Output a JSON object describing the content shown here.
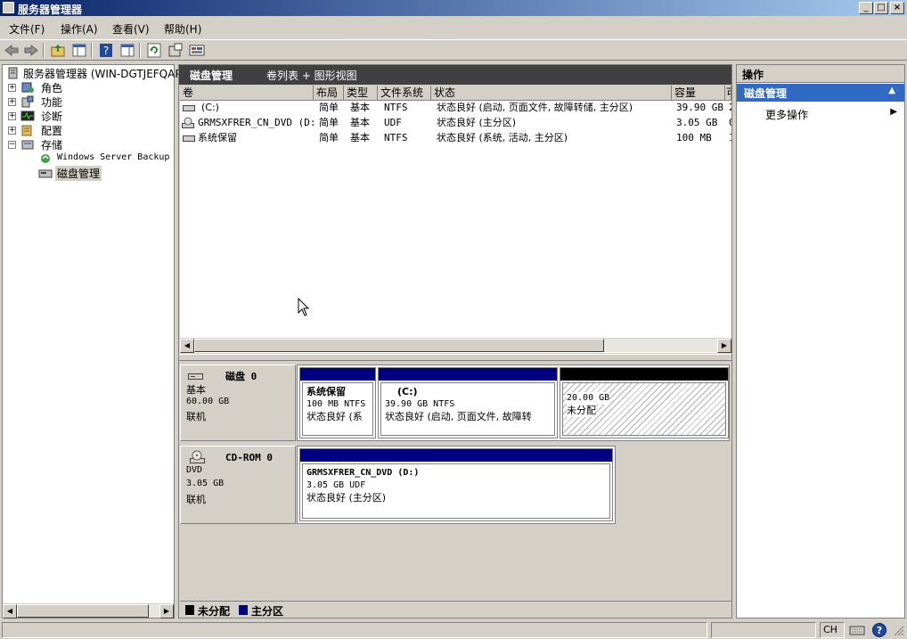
{
  "window": {
    "title": "服务器管理器",
    "controls": [
      "minimize",
      "maximize",
      "close"
    ]
  },
  "menubar": {
    "items": [
      "文件(F)",
      "操作(A)",
      "查看(V)",
      "帮助(H)"
    ]
  },
  "toolbar": {
    "icons": [
      "back-arrow-icon",
      "forward-arrow-icon",
      "up-folder-icon",
      "console-tree-icon",
      "help-icon",
      "properties-pane-icon",
      "refresh-icon",
      "properties-icon",
      "disk-settings-icon"
    ]
  },
  "tree": {
    "root": "服务器管理器 (WIN-DGTJEFQAPR",
    "items": [
      {
        "label": "角色",
        "expander": "+"
      },
      {
        "label": "功能",
        "expander": "+"
      },
      {
        "label": "诊断",
        "expander": "+"
      },
      {
        "label": "配置",
        "expander": "+"
      },
      {
        "label": "存储",
        "expander": "−"
      }
    ],
    "children": [
      "Windows Server Backup",
      "磁盘管理"
    ]
  },
  "center": {
    "title": "磁盘管理",
    "view_label": "卷列表 + 图形视图",
    "columns": [
      "卷",
      "布局",
      "类型",
      "文件系统",
      "状态",
      "容量",
      "可"
    ],
    "rows": [
      {
        "volume": "(C:)",
        "layout": "简单",
        "type": "基本",
        "fs": "NTFS",
        "status": "状态良好 (启动, 页面文件, 故障转储, 主分区)",
        "capacity": "39.90 GB",
        "free": "2"
      },
      {
        "volume": "GRMSXFRER_CN_DVD (D:)",
        "layout": "简单",
        "type": "基本",
        "fs": "UDF",
        "status": "状态良好 (主分区)",
        "capacity": "3.05 GB",
        "free": "0"
      },
      {
        "volume": "系统保留",
        "layout": "简单",
        "type": "基本",
        "fs": "NTFS",
        "status": "状态良好 (系统, 活动, 主分区)",
        "capacity": "100 MB",
        "free": "1"
      }
    ],
    "disks": [
      {
        "name": "磁盘 0",
        "kind": "基本",
        "size": "60.00 GB",
        "state": "联机",
        "partitions": [
          {
            "title": "系统保留",
            "line2": "100 MB NTFS",
            "line3": "状态良好 (系"
          },
          {
            "title": "(C:)",
            "line2": "39.90 GB NTFS",
            "line3": "状态良好 (启动, 页面文件, 故障转"
          },
          {
            "title": "",
            "line2": "20.00 GB",
            "line3": "未分配"
          }
        ]
      },
      {
        "name": "CD-ROM 0",
        "kind": "DVD",
        "size": "3.05 GB",
        "state": "联机",
        "partitions": [
          {
            "title": "GRMSXFRER_CN_DVD  (D:)",
            "line2": "3.05 GB UDF",
            "line3": "状态良好 (主分区)"
          }
        ]
      }
    ],
    "legend": [
      {
        "label": "未分配",
        "color": "#000000"
      },
      {
        "label": "主分区",
        "color": "#000080"
      }
    ]
  },
  "actions": {
    "header": "操作",
    "section": "磁盘管理",
    "items": [
      "更多操作"
    ]
  },
  "statusbar": {
    "lang": "CH"
  },
  "colors": {
    "primary_partition": "#000080",
    "unallocated": "#000000",
    "selection": "#316ac5",
    "header_dark": "#404040"
  }
}
